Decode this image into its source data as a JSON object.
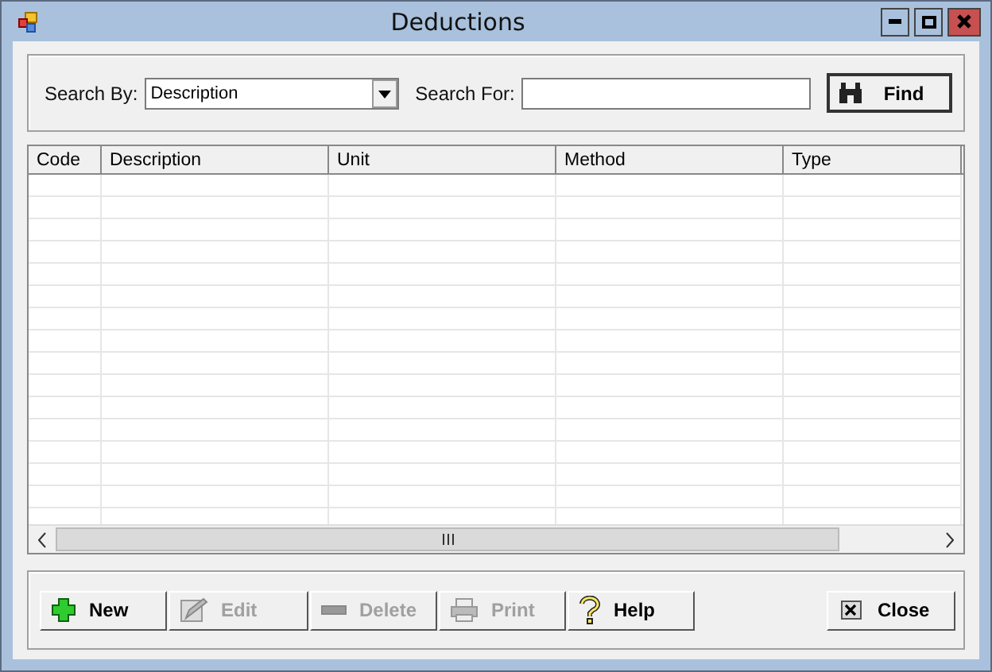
{
  "window": {
    "title": "Deductions"
  },
  "search": {
    "by_label": "Search By:",
    "by_value": "Description",
    "for_label": "Search For:",
    "find_button": "Find"
  },
  "table": {
    "columns": [
      "Code",
      "Description",
      "Unit",
      "Method",
      "Type"
    ]
  },
  "buttons": [
    {
      "label": "New",
      "kind": "new",
      "disabled": false
    },
    {
      "label": "Edit",
      "kind": "edit",
      "disabled": true
    },
    {
      "label": "Delete",
      "kind": "delete",
      "disabled": true
    },
    {
      "label": "Print",
      "kind": "print",
      "disabled": true
    },
    {
      "label": "Help",
      "kind": "help",
      "disabled": false
    }
  ],
  "close_button": "Close"
}
